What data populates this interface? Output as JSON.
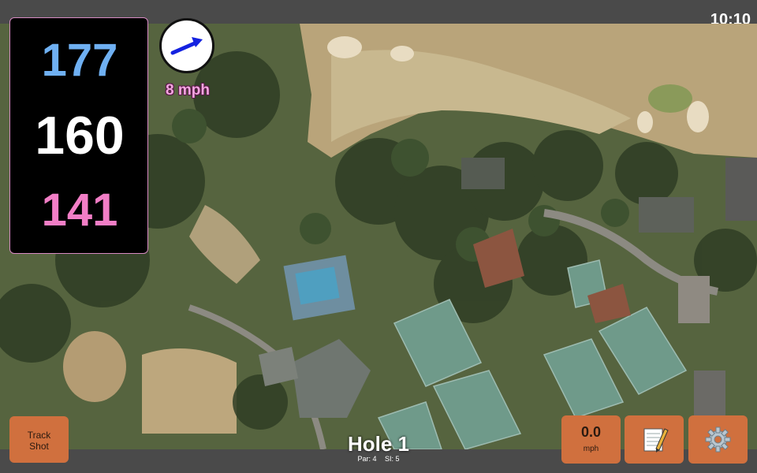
{
  "status_bar": {
    "time": "10:10"
  },
  "distances": {
    "back": "177",
    "middle": "160",
    "front": "141"
  },
  "wind": {
    "speed_label": "8 mph",
    "arrow_color": "#1422e0"
  },
  "buttons": {
    "track_shot_line1": "Track",
    "track_shot_line2": "Shot",
    "speed_value": "0.0",
    "speed_unit": "mph",
    "notes_icon": "notepad-pencil-icon",
    "settings_icon": "gear-icon"
  },
  "hole": {
    "title": "Hole 1",
    "par": "Par: 4",
    "si": "SI: 5"
  },
  "colors": {
    "accent_button": "#d0703e",
    "distance_back": "#6fb0f2",
    "distance_middle": "#ffffff",
    "distance_front": "#f27ec6",
    "wind_label": "#f4a6e0"
  }
}
